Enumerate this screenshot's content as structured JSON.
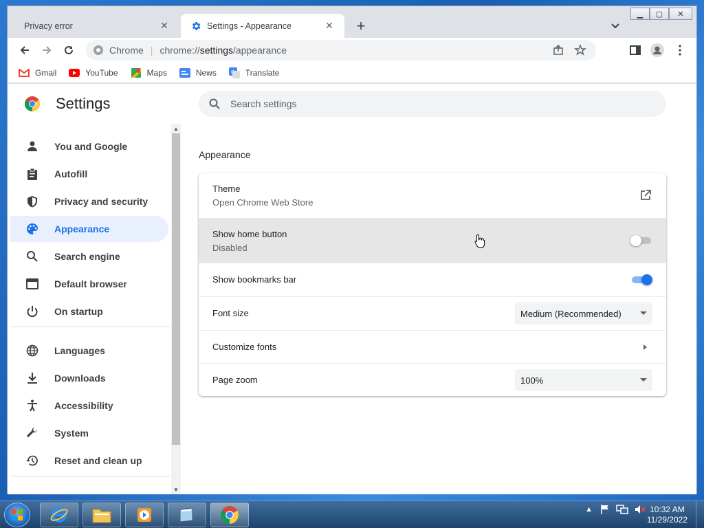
{
  "tabs": [
    {
      "title": "Privacy error",
      "active": false
    },
    {
      "title": "Settings - Appearance",
      "active": true
    }
  ],
  "omnibox": {
    "site": "Chrome",
    "url_scheme": "chrome://",
    "url_host": "settings",
    "url_path": "/appearance"
  },
  "bookmarks": [
    {
      "label": "Gmail",
      "icon": "gmail-icon"
    },
    {
      "label": "YouTube",
      "icon": "youtube-icon"
    },
    {
      "label": "Maps",
      "icon": "maps-icon"
    },
    {
      "label": "News",
      "icon": "news-icon"
    },
    {
      "label": "Translate",
      "icon": "translate-icon"
    }
  ],
  "settings": {
    "title": "Settings",
    "search_placeholder": "Search settings"
  },
  "sidebar": {
    "items": [
      {
        "label": "You and Google",
        "icon": "person-icon"
      },
      {
        "label": "Autofill",
        "icon": "clipboard-icon"
      },
      {
        "label": "Privacy and security",
        "icon": "shield-icon"
      },
      {
        "label": "Appearance",
        "icon": "palette-icon",
        "selected": true
      },
      {
        "label": "Search engine",
        "icon": "search-icon"
      },
      {
        "label": "Default browser",
        "icon": "browser-icon"
      },
      {
        "label": "On startup",
        "icon": "power-icon"
      },
      {
        "label": "Languages",
        "icon": "globe-icon"
      },
      {
        "label": "Downloads",
        "icon": "download-icon"
      },
      {
        "label": "Accessibility",
        "icon": "accessibility-icon"
      },
      {
        "label": "System",
        "icon": "wrench-icon"
      },
      {
        "label": "Reset and clean up",
        "icon": "history-icon"
      }
    ]
  },
  "appearance": {
    "section_title": "Appearance",
    "theme": {
      "label": "Theme",
      "sub": "Open Chrome Web Store"
    },
    "home_button": {
      "label": "Show home button",
      "sub": "Disabled",
      "enabled": false
    },
    "bookmarks_bar": {
      "label": "Show bookmarks bar",
      "enabled": true
    },
    "font_size": {
      "label": "Font size",
      "value": "Medium (Recommended)"
    },
    "customize_fonts": {
      "label": "Customize fonts"
    },
    "page_zoom": {
      "label": "Page zoom",
      "value": "100%"
    }
  },
  "taskbar": {
    "time": "10:32 AM",
    "date": "11/29/2022"
  },
  "colors": {
    "accent": "#1a73e8",
    "selected_bg": "#e8f0fe"
  }
}
